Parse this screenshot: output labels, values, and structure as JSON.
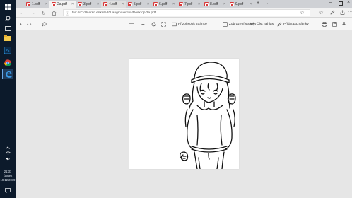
{
  "taskbar": {
    "time": "21:31",
    "weekday": "čtvrtek",
    "date": "19.12.2019"
  },
  "tabs": [
    {
      "label": "1.pdf"
    },
    {
      "label": "2a.pdf"
    },
    {
      "label": "3.pdf"
    },
    {
      "label": "4.pdf"
    },
    {
      "label": "5.pdf"
    },
    {
      "label": "6.pdf"
    },
    {
      "label": "7.pdf"
    },
    {
      "label": "8.pdf"
    },
    {
      "label": "9.pdf"
    }
  ],
  "address": {
    "url": "file:///C:/Users/Lenka%20Langmaierová/Desktop/2a.pdf"
  },
  "pdf_toolbar": {
    "page_number": "1",
    "page_total": "z 1",
    "zoom_minus": "—",
    "zoom_plus": "+",
    "fit_page": "Přizpůsobit stránce",
    "page_view": "Zobrazení stránky",
    "read_aloud": "Číst nahlas",
    "add_notes": "Přidat poznámky"
  }
}
